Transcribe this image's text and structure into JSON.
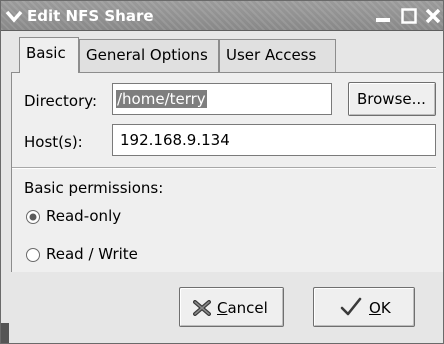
{
  "window": {
    "title": "Edit NFS Share"
  },
  "tabs": [
    {
      "label": "Basic",
      "active": true
    },
    {
      "label": "General Options",
      "active": false
    },
    {
      "label": "User Access",
      "active": false
    }
  ],
  "basic": {
    "directory_label": "Directory:",
    "directory_value": "/home/terry",
    "browse_label": "Browse...",
    "host_label": "Host(s):",
    "host_value": "192.168.9.134",
    "permissions_heading": "Basic permissions:",
    "permissions_options": [
      {
        "label": "Read-only",
        "selected": true
      },
      {
        "label": "Read / Write",
        "selected": false
      }
    ]
  },
  "buttons": {
    "cancel_label_mnemonic": "C",
    "cancel_label_rest": "ancel",
    "ok_label_mnemonic": "O",
    "ok_label_rest": "K"
  },
  "colors": {
    "titlebar": "#8f8f8f",
    "dialog_bg": "#efefef",
    "selection": "#7e7e7e"
  },
  "icons": {
    "window_menu": "chevron-down-icon",
    "minimize": "minimize-icon",
    "maximize": "maximize-icon",
    "close": "close-icon",
    "cancel": "cancel-x-icon",
    "ok": "checkmark-icon"
  }
}
